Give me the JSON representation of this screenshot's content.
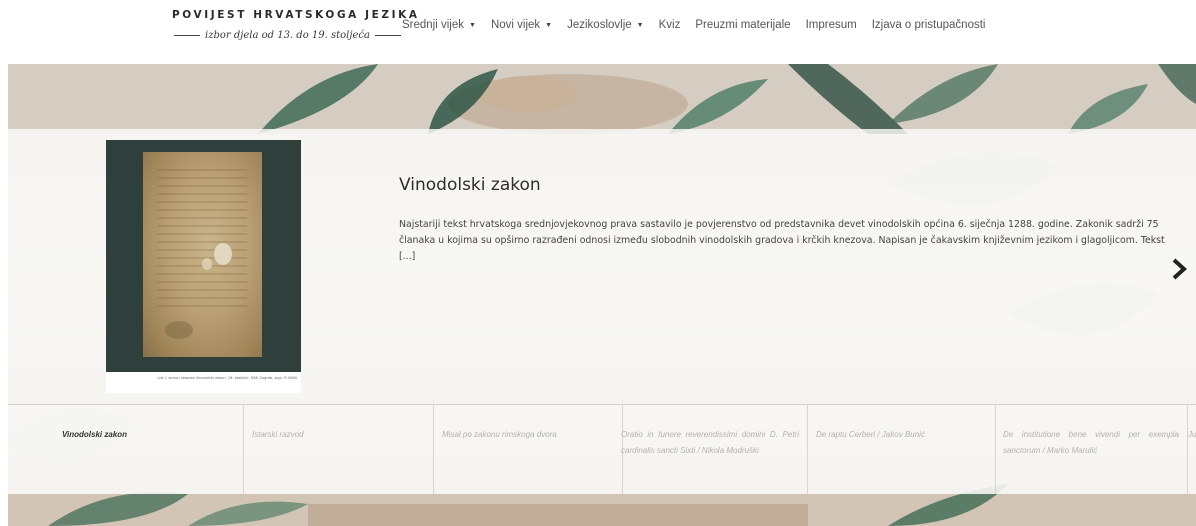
{
  "logo": {
    "title": "POVIJEST HRVATSKOGA JEZIKA",
    "subtitle": "izbor djela od 13. do 19. stoljeća"
  },
  "nav": [
    {
      "label": "Srednji vijek",
      "dropdown": true
    },
    {
      "label": "Novi vijek",
      "dropdown": true
    },
    {
      "label": "Jezikoslovlje",
      "dropdown": true
    },
    {
      "label": "Kviz",
      "dropdown": false
    },
    {
      "label": "Preuzmi materijale",
      "dropdown": false
    },
    {
      "label": "Impresum",
      "dropdown": false
    },
    {
      "label": "Izjava o pristupačnosti",
      "dropdown": false
    }
  ],
  "slide": {
    "title": "Vinodolski zakon",
    "description": "Najstariji tekst hrvatskoga srednjovjekovnog prava sastavilo je povjerenstvo od predstavnika devet vinodolskih općina 6. siječnja 1288. godine. Zakonik sadrži 75 članaka u kojima su opširno razrađeni odnosi između slobodnih vinodolskih gradova i krčkih knezova. Napisan je čakavskim književnim jezikom i glagoljicom. Tekst [...]",
    "image_caption": "List 1 verso rukopisa Vinodolski zakon, 16. stoljeće, NSK Zagreb, sign. R 4080"
  },
  "next_icon": "chevron-right-icon",
  "thumbnails": [
    {
      "label": "Vinodolski zakon",
      "active": true
    },
    {
      "label": "Istarski razvod",
      "active": false
    },
    {
      "label": "Misal po zakonu rimskoga dvora",
      "active": false
    },
    {
      "label": "Oratio in funere reverendissimi domini D. Petri cardinalis sancti Sixti / Nikola Modruški",
      "active": false
    },
    {
      "label": "De raptu Cerberi / Jakov Bunić",
      "active": false
    },
    {
      "label": "De institutione bene vivendi per exempla sanctorum / Marko Marulić",
      "active": false
    },
    {
      "label": "Ju",
      "active": false
    }
  ],
  "colors": {
    "panel": "#fafaf9",
    "title_text": "#2e2e2e",
    "inactive_thumb": "#b5b0ab",
    "doc_background": "#2f3f3b"
  }
}
